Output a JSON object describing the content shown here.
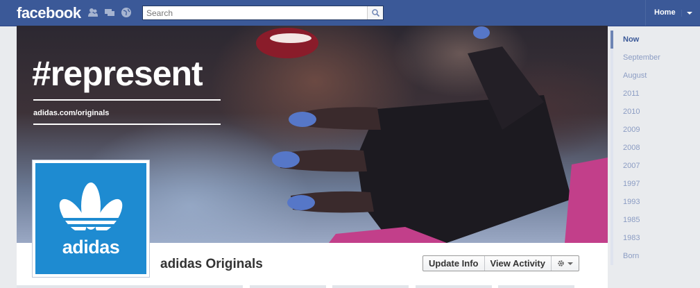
{
  "header": {
    "logo": "facebook",
    "search_placeholder": "Search",
    "home_label": "Home"
  },
  "cover": {
    "headline": "#represent",
    "url": "adidas.com/originals"
  },
  "profile": {
    "brand_text": "adidas",
    "name": "adidas Originals"
  },
  "actions": {
    "update_info": "Update Info",
    "view_activity": "View Activity"
  },
  "timeline": {
    "items": [
      "Now",
      "September",
      "August",
      "2011",
      "2010",
      "2009",
      "2008",
      "2007",
      "1997",
      "1993",
      "1985",
      "1983",
      "Born"
    ]
  },
  "colors": {
    "brand_blue": "#3b5998",
    "profile_blue": "#1e8bd1"
  }
}
